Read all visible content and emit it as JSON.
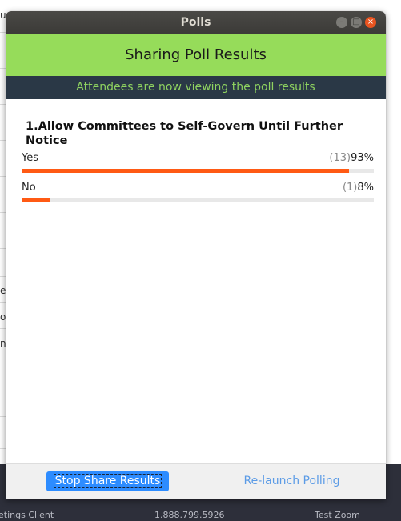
{
  "background": {
    "left_fragments": [
      "ue",
      "es",
      "ol",
      "ne"
    ],
    "footer": {
      "left_text": "etings Client",
      "phone": "1.888.799.5926",
      "right_text": "Test Zoom"
    }
  },
  "window": {
    "title": "Polls",
    "controls": {
      "minimize": "–",
      "maximize": "□",
      "close": "×"
    }
  },
  "header": {
    "title": "Sharing Poll Results",
    "subtitle": "Attendees are now viewing the poll results"
  },
  "poll": {
    "question": "1.Allow Committees to Self-Govern Until Further Notice",
    "answers": [
      {
        "label": "Yes",
        "count": "(13)",
        "percent": "93%",
        "fraction": 0.93
      },
      {
        "label": "No",
        "count": "(1)",
        "percent": "8%",
        "fraction": 0.08
      }
    ]
  },
  "buttons": {
    "stop_share": "Stop Share Results",
    "relaunch": "Re-launch Polling"
  },
  "colors": {
    "header_green": "#96dc5a",
    "header_dark": "#2a3846",
    "bar": "#ff5a14",
    "button_blue": "#2d8cff"
  }
}
